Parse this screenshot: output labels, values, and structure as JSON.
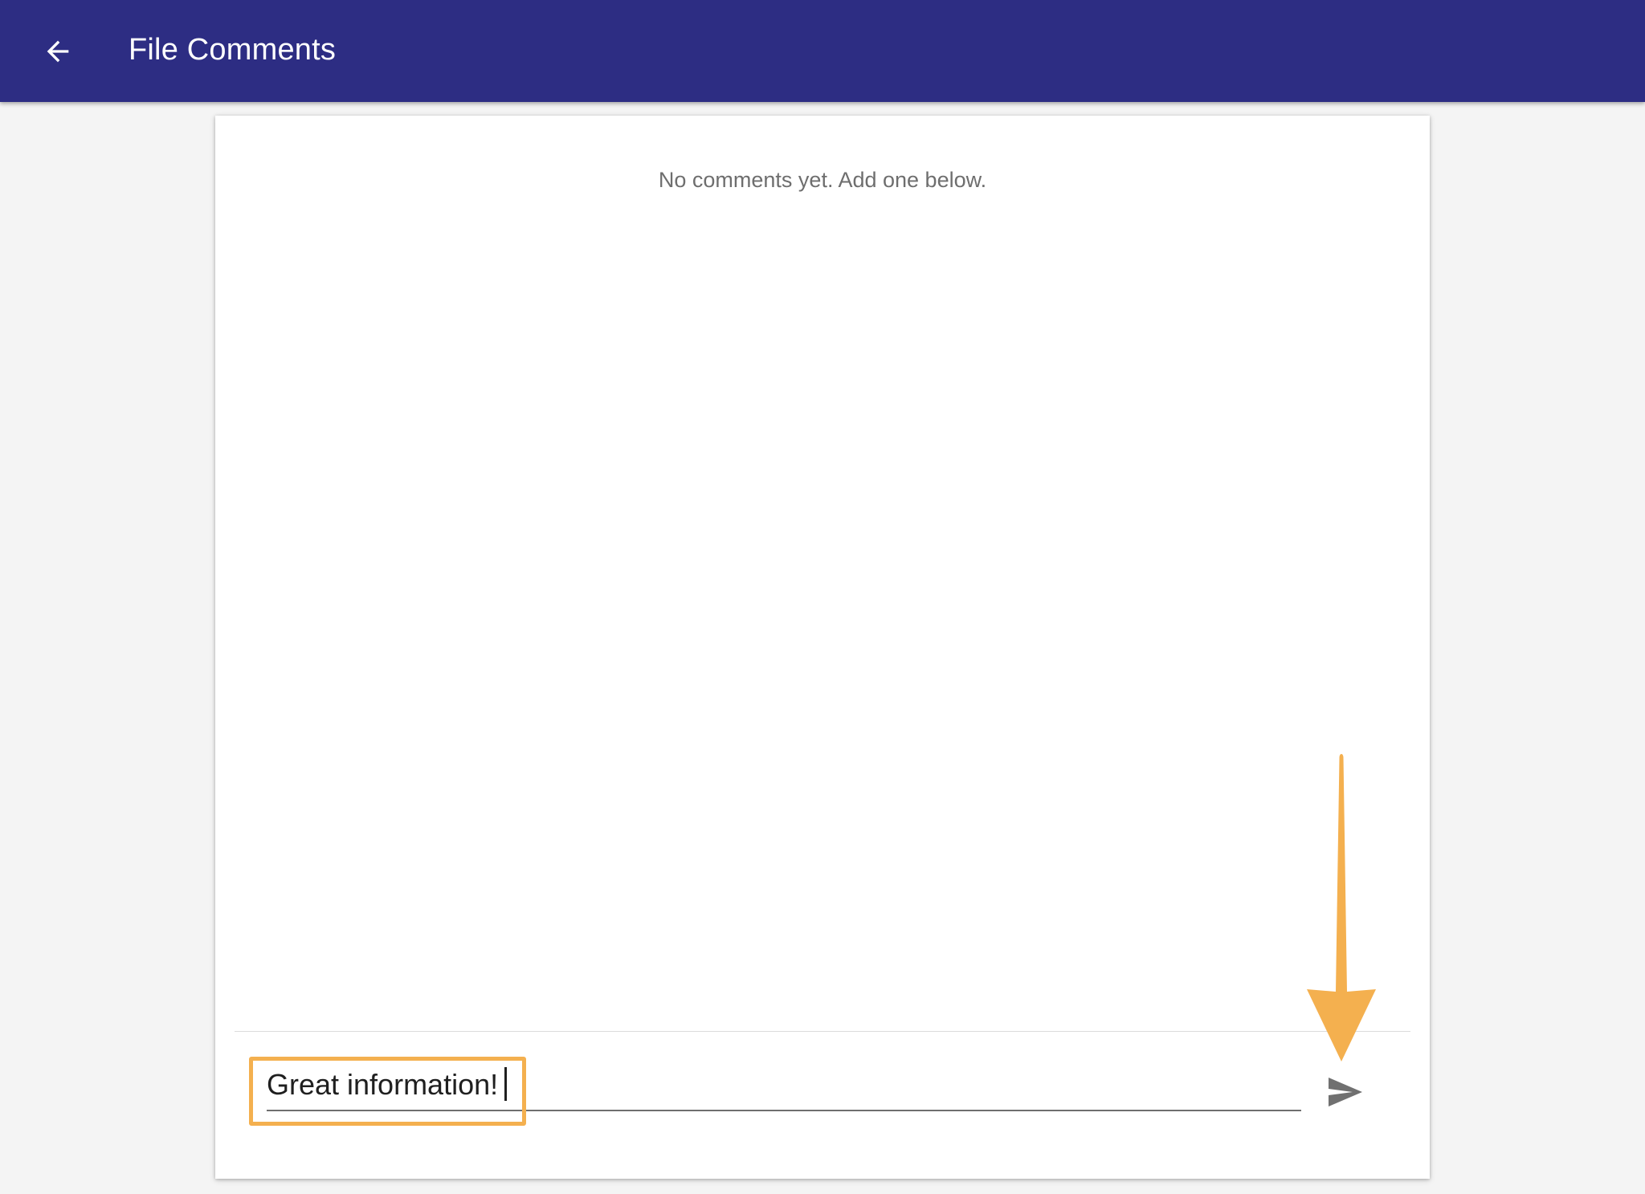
{
  "appbar": {
    "title": "File Comments",
    "back_icon": "arrow-back-icon",
    "background_color": "#2d2d83"
  },
  "comments": {
    "empty_message": "No comments yet. Add one below."
  },
  "composer": {
    "input_value": "Great information!",
    "send_icon": "send-icon"
  },
  "annotations": {
    "highlight_color": "#f4b04f",
    "arrow_icon": "down-arrow-annotation-icon"
  }
}
